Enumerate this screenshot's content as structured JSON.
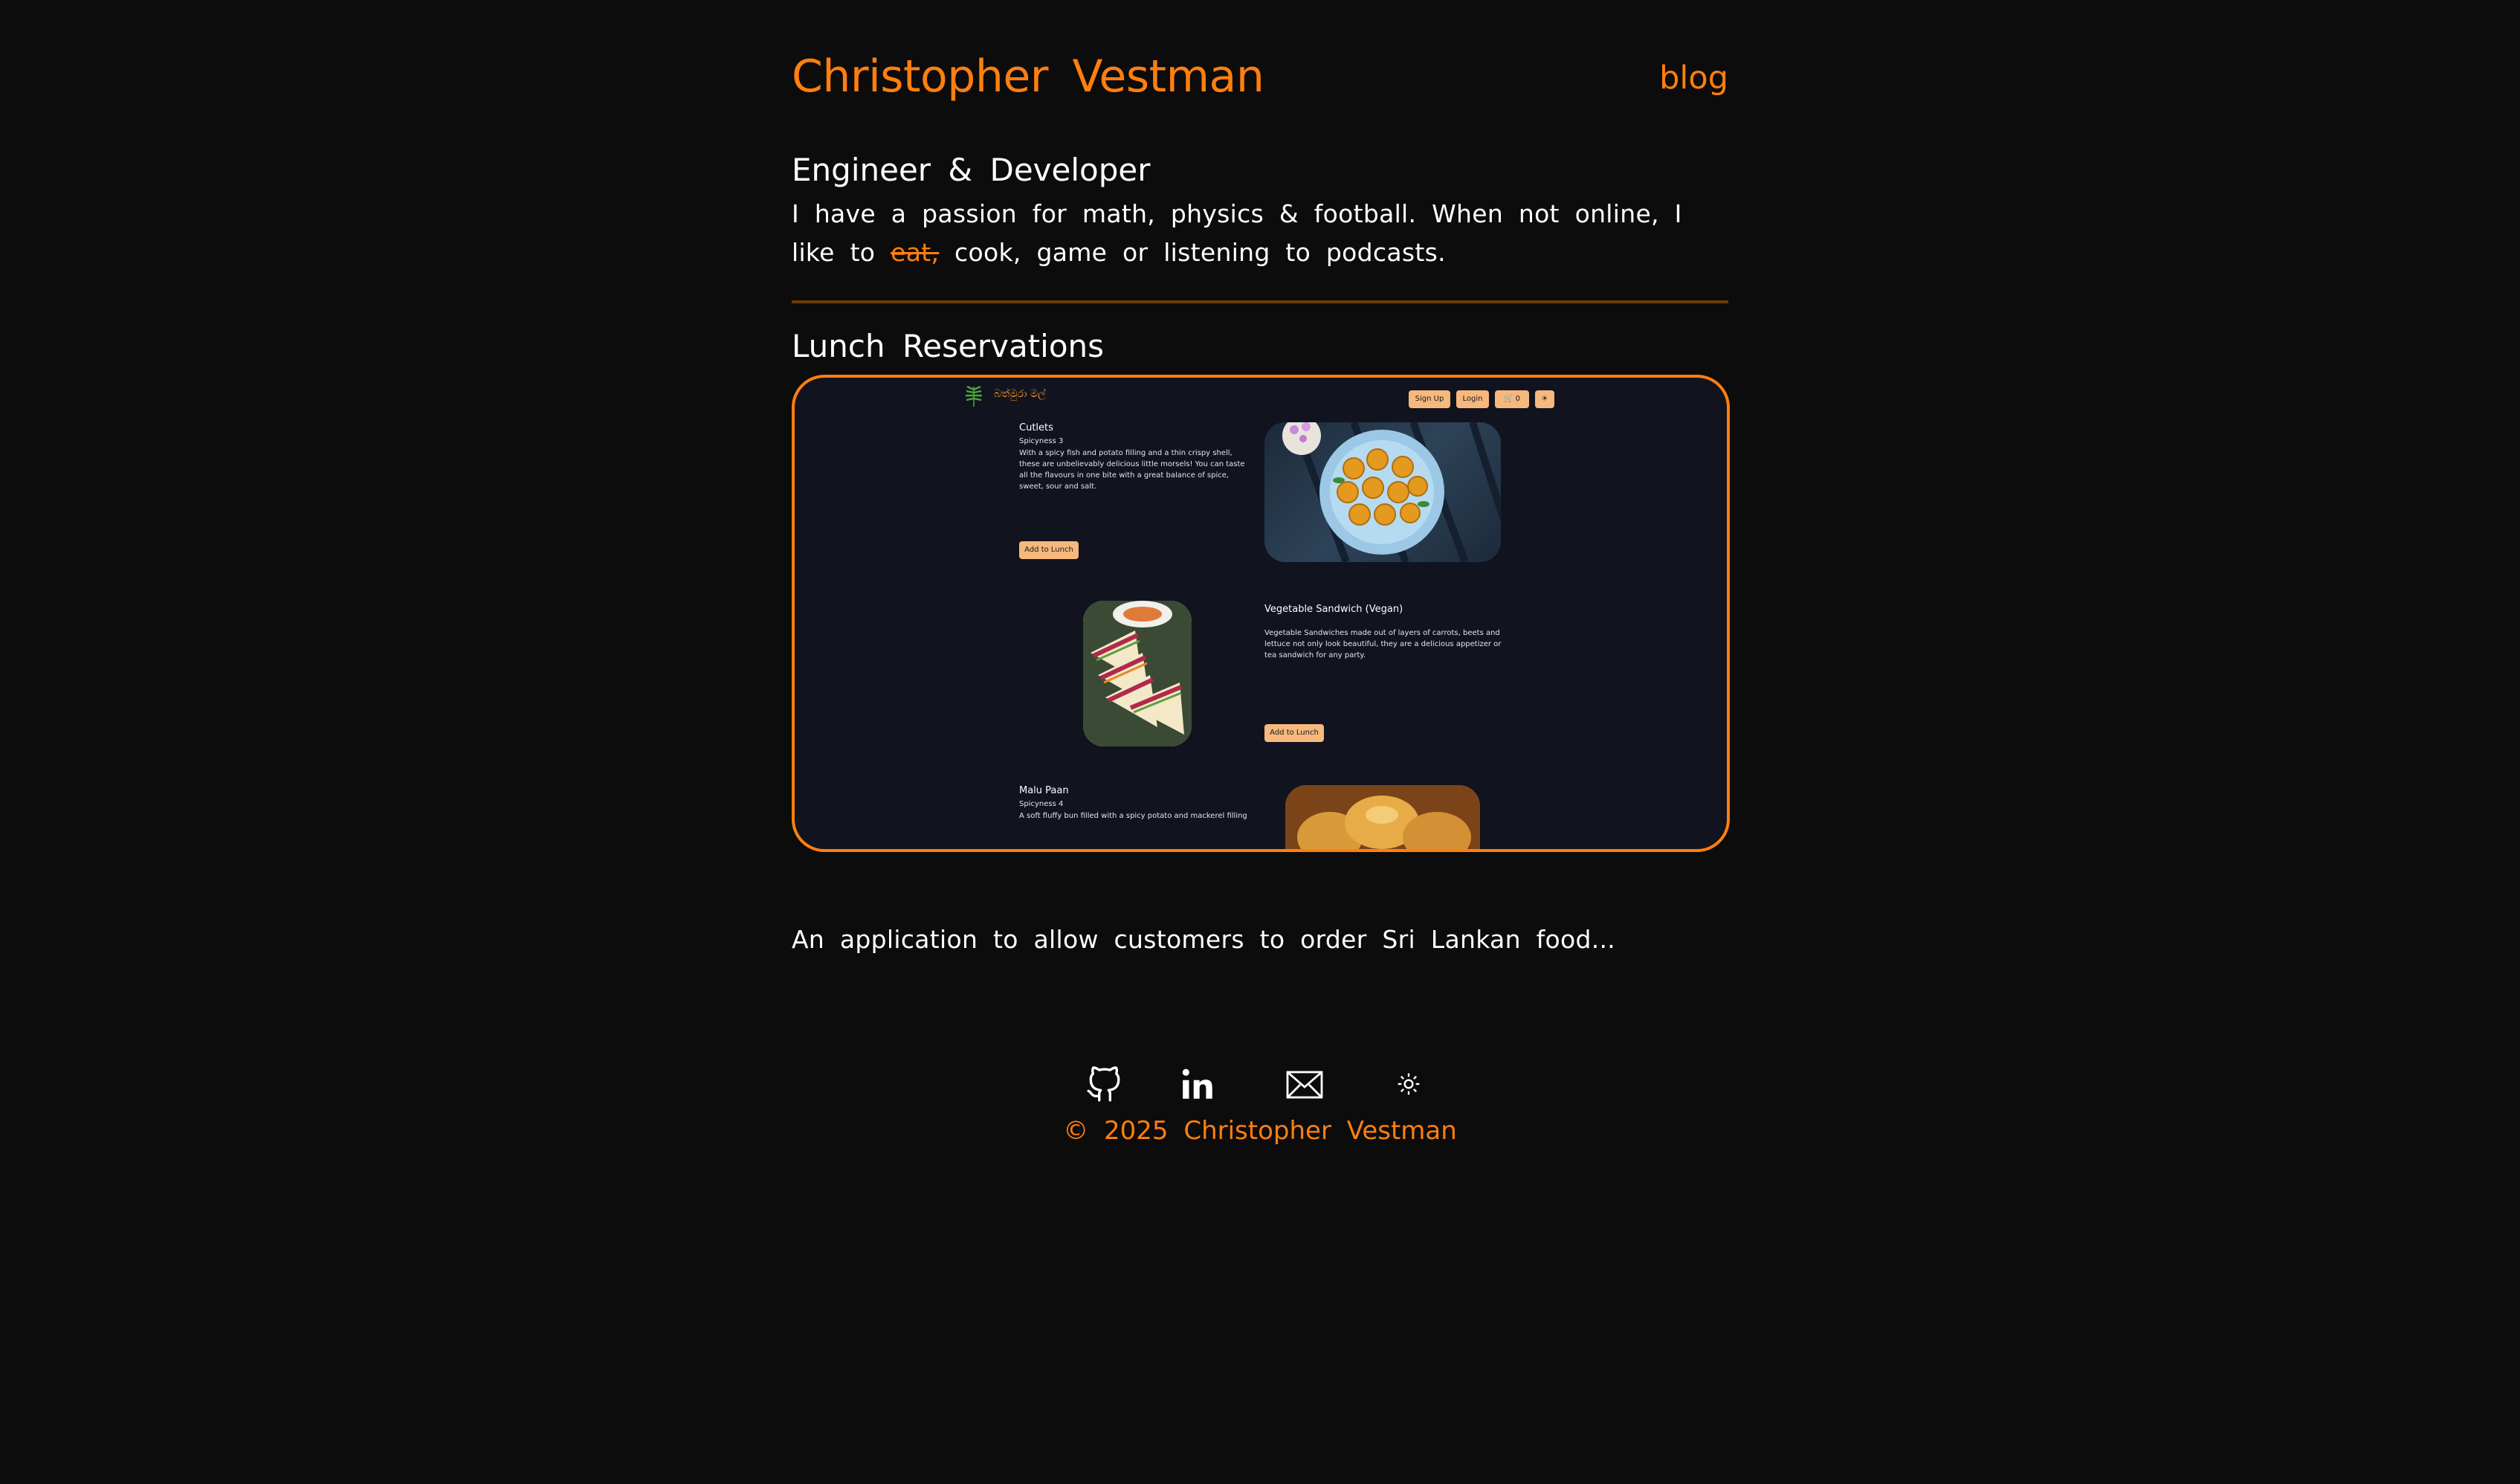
{
  "header": {
    "site_title": "Christopher Vestman",
    "nav_blog": "blog"
  },
  "intro": {
    "heading": "Engineer & Developer",
    "bio_before": "I have a passion for math, physics & football. When not online, I like to ",
    "bio_struck": "eat,",
    "bio_after": " cook, game or listening to podcasts."
  },
  "project": {
    "title": "Lunch Reservations",
    "description": "An application to allow customers to order Sri Lankan food...",
    "preview": {
      "logo_text": "බත්මුරා මල්",
      "nav_buttons": [
        "Sign Up",
        "Login"
      ],
      "cart_count": "0",
      "dishes": [
        {
          "name": "Cutlets",
          "spice": "Spicyness 3",
          "description": "With a spicy fish and potato filling and a thin crispy shell, these are unbelievably delicious little morsels! You can taste all the flavours in one bite with a great balance of spice, sweet, sour and salt.",
          "button": "Add to Lunch"
        },
        {
          "name": "Vegetable Sandwich (Vegan)",
          "spice": "",
          "description": "Vegetable Sandwiches made out of layers of carrots, beets and lettuce not only look beautiful, they are a delicious appetizer or tea sandwich for any party.",
          "button": "Add to Lunch"
        },
        {
          "name": "Malu Paan",
          "spice": "Spicyness 4",
          "description": "A soft fluffy bun filled with a spicy potato and mackerel filling",
          "button": ""
        }
      ]
    }
  },
  "footer": {
    "icons": [
      "github-icon",
      "linkedin-icon",
      "mail-icon",
      "theme-toggle-icon"
    ],
    "copyright": "© 2025 Christopher Vestman"
  },
  "colors": {
    "background": "#0c0c0c",
    "accent": "#ff7f0e",
    "text": "#ffffff",
    "divider": "#6b3c06"
  }
}
